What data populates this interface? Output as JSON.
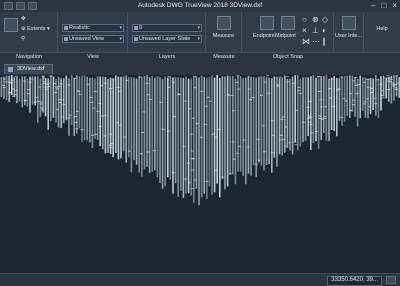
{
  "window": {
    "title": "Autodesk DWG TrueView 2018    3DView.dxf"
  },
  "ribbon": {
    "navigation": {
      "label": "Navigation",
      "extents_label": "Extents"
    },
    "view": {
      "label": "View",
      "visual_style": "Realistic",
      "named_view": "Unsaved View"
    },
    "layers": {
      "label": "Layers",
      "layer_state": "Unsaved Layer State",
      "layer_value": "0"
    },
    "measure": {
      "label": "Measure",
      "button_label": "Measure"
    },
    "object_snap": {
      "label": "Object Snap",
      "endpoint_label": "Endpoint",
      "midpoint_label": "Midpoint"
    },
    "user_interface": {
      "label": "User Inte..."
    },
    "help": {
      "label": "Help"
    }
  },
  "tabs": [
    {
      "label": "3DView.dxf"
    }
  ],
  "status": {
    "coordinates": "33350.6420, 39..."
  },
  "colors": {
    "background": "#1c2532",
    "column": "#c9d7d9",
    "column_shadow": "#8fa3a8"
  },
  "icons": [
    "extents-icon",
    "orbit-icon",
    "pan-icon",
    "measure-icon",
    "endpoint-icon",
    "midpoint-icon",
    "user-interface-icon"
  ]
}
